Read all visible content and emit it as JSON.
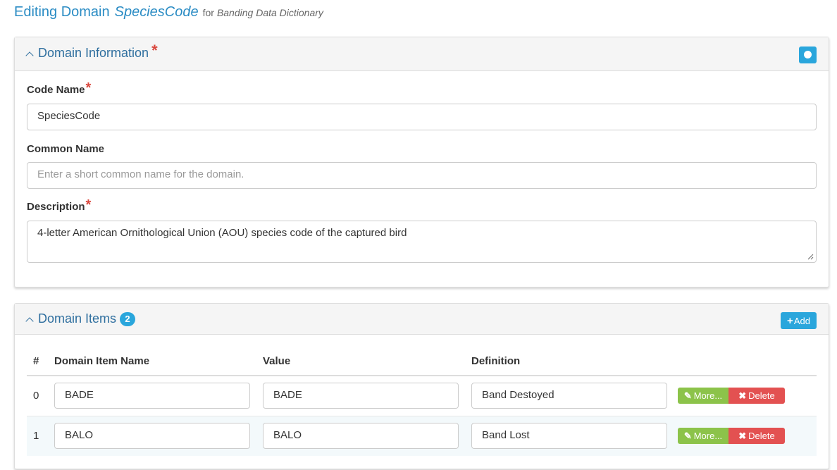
{
  "header": {
    "prefix": "Editing Domain",
    "code": "SpeciesCode",
    "for_text": "for",
    "dictionary": "Banding Data Dictionary"
  },
  "info_panel": {
    "title": "Domain Information",
    "required_mark": "*",
    "fields": {
      "code_name": {
        "label": "Code Name",
        "value": "SpeciesCode"
      },
      "common_name": {
        "label": "Common Name",
        "value": "",
        "placeholder": "Enter a short common name for the domain."
      },
      "description": {
        "label": "Description",
        "value": "4-letter American Ornithological Union (AOU) species code of the captured bird"
      }
    }
  },
  "items_panel": {
    "title": "Domain Items",
    "count": "2",
    "add_label": "Add",
    "columns": [
      "#",
      "Domain Item Name",
      "Value",
      "Definition"
    ],
    "rows": [
      {
        "index": "0",
        "name": "BADE",
        "value": "BADE",
        "definition": "Band Destoyed"
      },
      {
        "index": "1",
        "name": "BALO",
        "value": "BALO",
        "definition": "Band Lost"
      }
    ],
    "more_label": "More...",
    "delete_label": "Delete"
  },
  "colors": {
    "accent": "#2aa6dc",
    "heading_text": "#2f6f9f",
    "required": "#d9463c",
    "more_button": "#8cc34a",
    "delete_button": "#e35151"
  },
  "icons": [
    "chevron-up-icon",
    "circle-toggle-icon",
    "plus-icon",
    "pencil-icon",
    "times-icon",
    "resize-handle-icon"
  ]
}
